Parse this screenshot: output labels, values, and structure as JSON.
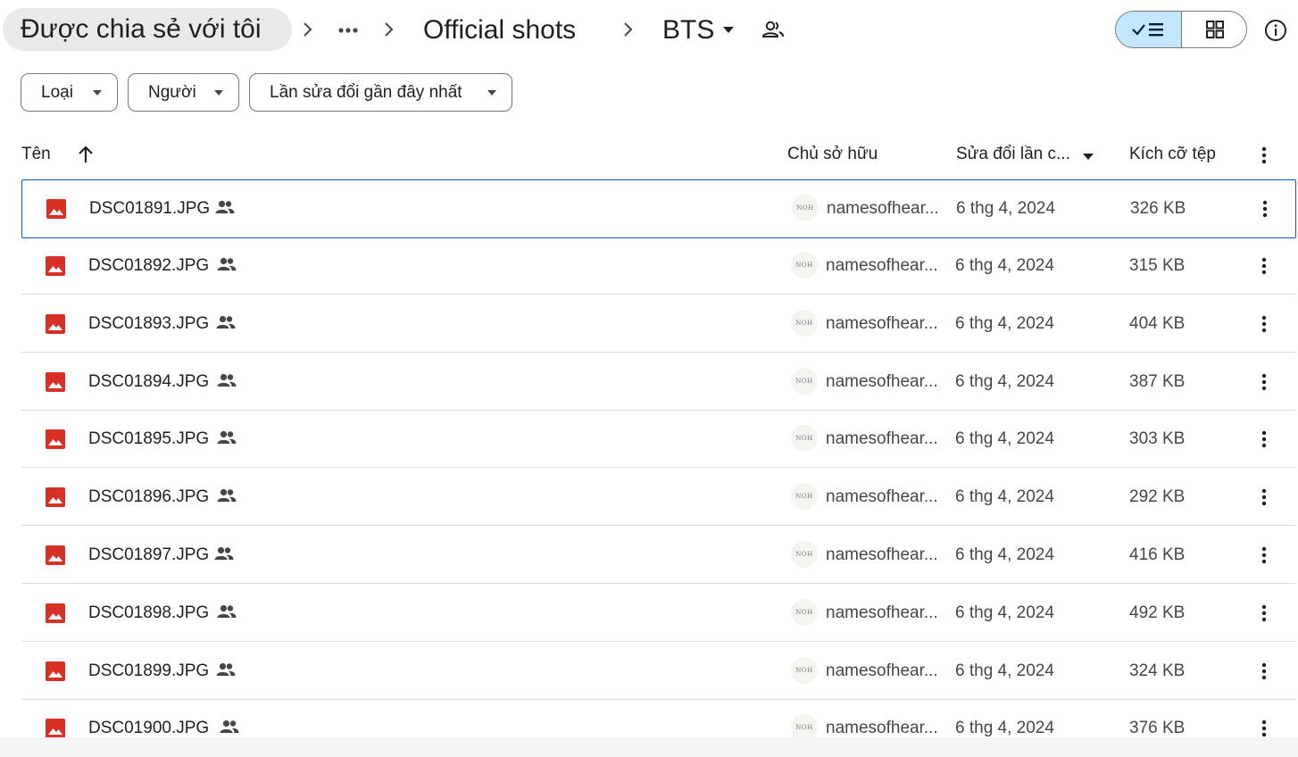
{
  "breadcrumb": {
    "root": "Được chia sẻ với tôi",
    "folder": "Official shots",
    "current": "BTS"
  },
  "filters": {
    "type": "Loại",
    "people": "Người",
    "modified": "Lần sửa đổi gần đây nhất"
  },
  "columns": {
    "name": "Tên",
    "owner": "Chủ sở hữu",
    "modified": "Sửa đổi lần c...",
    "size": "Kích cỡ tệp"
  },
  "colors": {
    "accent": "#0b57d0",
    "selected_toggle": "#c2e7ff",
    "image_icon": "#d93025"
  },
  "owner_avatar_text": "NOH",
  "files": [
    {
      "name": "DSC01891.JPG",
      "owner": "namesofhear...",
      "modified": "6 thg 4, 2024",
      "size": "326 KB"
    },
    {
      "name": "DSC01892.JPG",
      "owner": "namesofhear...",
      "modified": "6 thg 4, 2024",
      "size": "315 KB"
    },
    {
      "name": "DSC01893.JPG",
      "owner": "namesofhear...",
      "modified": "6 thg 4, 2024",
      "size": "404 KB"
    },
    {
      "name": "DSC01894.JPG",
      "owner": "namesofhear...",
      "modified": "6 thg 4, 2024",
      "size": "387 KB"
    },
    {
      "name": "DSC01895.JPG",
      "owner": "namesofhear...",
      "modified": "6 thg 4, 2024",
      "size": "303 KB"
    },
    {
      "name": "DSC01896.JPG",
      "owner": "namesofhear...",
      "modified": "6 thg 4, 2024",
      "size": "292 KB"
    },
    {
      "name": "DSC01897.JPG",
      "owner": "namesofhear...",
      "modified": "6 thg 4, 2024",
      "size": "416 KB"
    },
    {
      "name": "DSC01898.JPG",
      "owner": "namesofhear...",
      "modified": "6 thg 4, 2024",
      "size": "492 KB"
    },
    {
      "name": "DSC01899.JPG",
      "owner": "namesofhear...",
      "modified": "6 thg 4, 2024",
      "size": "324 KB"
    },
    {
      "name": "DSC01900.JPG",
      "owner": "namesofhear...",
      "modified": "6 thg 4, 2024",
      "size": "376 KB"
    }
  ]
}
